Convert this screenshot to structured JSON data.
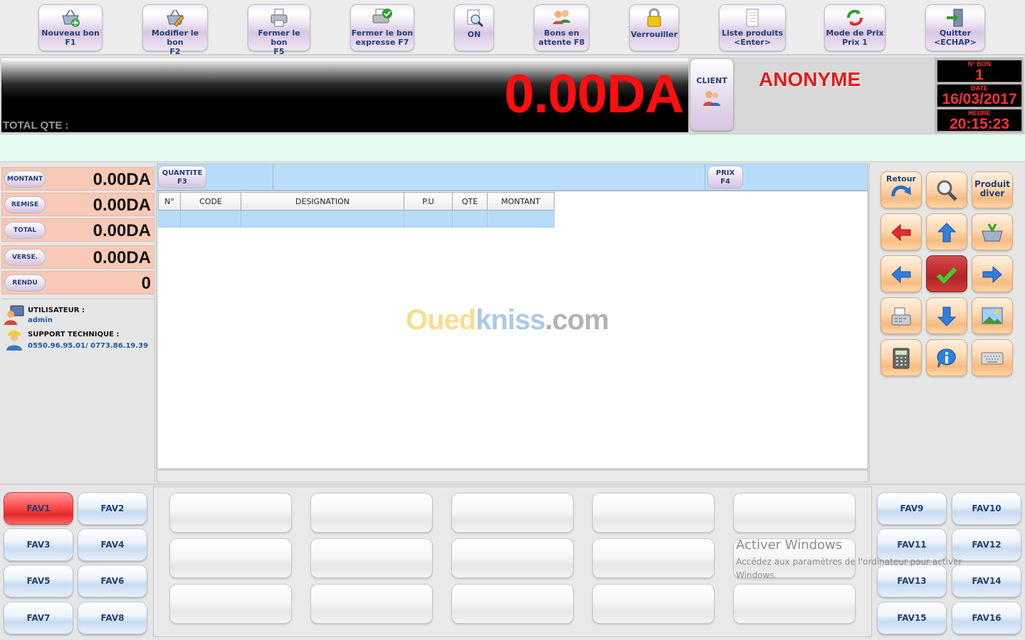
{
  "toolbar": {
    "nouveau": {
      "l1": "Nouveau bon",
      "l2": "F1"
    },
    "modifier": {
      "l1": "Modifier le bon",
      "l2": "F2"
    },
    "fermer": {
      "l1": "Fermer le bon",
      "l2": "F5"
    },
    "fermer_express": {
      "l1": "Fermer le bon",
      "l2": "expresse F7"
    },
    "on": {
      "l1": "ON"
    },
    "attente": {
      "l1": "Bons en",
      "l2": "attente F8"
    },
    "verrouiller": {
      "l1": "Verrouiller"
    },
    "liste": {
      "l1": "Liste produits",
      "l2": "<Enter>"
    },
    "mode_prix": {
      "l1": "Mode de Prix",
      "l2": "Prix 1"
    },
    "quitter": {
      "l1": "Quitter",
      "l2": "<ECHAP>"
    }
  },
  "display": {
    "total_amount": "0.00DA",
    "total_qte_label": "TOTAL QTE :",
    "client_label": "CLIENT",
    "client_name": "ANONYME",
    "no_bon_label": "N° BON",
    "no_bon": "1",
    "date_label": "DATE",
    "date": "16/03/2017",
    "heure_label": "HEURE",
    "heure": "20:15:23"
  },
  "summary": {
    "montant": {
      "label": "MONTANT",
      "value": "0.00DA"
    },
    "remise": {
      "label": "REMISE",
      "value": "0.00DA"
    },
    "total": {
      "label": "TOTAL",
      "value": "0.00DA"
    },
    "verse": {
      "label": "VERSE.",
      "value": "0.00DA"
    },
    "rendu": {
      "label": "RENDU",
      "value": "0"
    }
  },
  "user": {
    "label": "UTILISATEUR :",
    "name": "admin",
    "support_label": "SUPPORT TECHNIQUE :",
    "support_phone": "0550.96.95.01/ 0773.86.19.39"
  },
  "entry": {
    "quantite_l1": "QUANTITE",
    "quantite_l2": "F3",
    "prix_l1": "PRIX",
    "prix_l2": "F4"
  },
  "grid": {
    "columns": [
      "N°",
      "CODE",
      "DESIGNATION",
      "P.U",
      "QTE",
      "MONTANT"
    ]
  },
  "watermark": {
    "a": "Oued",
    "b": "kniss",
    "c": ".com"
  },
  "keypad": {
    "retour": "Retour",
    "produit_l1": "Produit",
    "produit_l2": "diver"
  },
  "favorites": {
    "left": [
      "FAV1",
      "FAV2",
      "FAV3",
      "FAV4",
      "FAV5",
      "FAV6",
      "FAV7",
      "FAV8"
    ],
    "right": [
      "FAV9",
      "FAV10",
      "FAV11",
      "FAV12",
      "FAV13",
      "FAV14",
      "FAV15",
      "FAV16"
    ],
    "active": "FAV1"
  },
  "windows_activation": {
    "title": "Activer Windows",
    "subtitle": "Accédez aux paramètres de l'ordinateur pour activer Windows."
  },
  "colors": {
    "amount_red": "#ff0f0f",
    "client_red": "#e21a1a",
    "summary_bg": "#f8c9b6",
    "grid_row": "#b7dcfa",
    "label_blue": "#243e74",
    "favorite_active": "#ff4c4c"
  }
}
